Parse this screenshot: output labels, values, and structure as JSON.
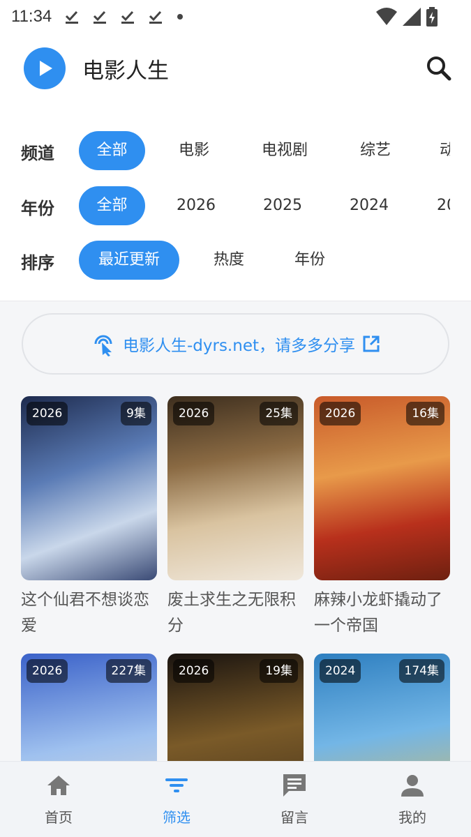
{
  "status_bar": {
    "time": "11:34"
  },
  "app": {
    "title": "电影人生"
  },
  "filters": {
    "channel": {
      "label": "频道",
      "options": [
        "全部",
        "电影",
        "电视剧",
        "综艺",
        "动"
      ]
    },
    "year": {
      "label": "年份",
      "options": [
        "全部",
        "2026",
        "2025",
        "2024",
        "20"
      ]
    },
    "sort": {
      "label": "排序",
      "options": [
        "最近更新",
        "热度",
        "年份"
      ]
    }
  },
  "share": {
    "text": "电影人生-dyrs.net，请多多分享"
  },
  "cards": [
    {
      "year": "2026",
      "episodes": "9集",
      "title": "这个仙君不想谈恋爱"
    },
    {
      "year": "2026",
      "episodes": "25集",
      "title": "废土求生之无限积分"
    },
    {
      "year": "2026",
      "episodes": "16集",
      "title": "麻辣小龙虾撬动了一个帝国"
    },
    {
      "year": "2026",
      "episodes": "227集",
      "title": ""
    },
    {
      "year": "2026",
      "episodes": "19集",
      "title": ""
    },
    {
      "year": "2024",
      "episodes": "174集",
      "title": ""
    }
  ],
  "bottom_nav": [
    {
      "label": "首页",
      "icon": "home-icon"
    },
    {
      "label": "筛选",
      "icon": "filter-icon"
    },
    {
      "label": "留言",
      "icon": "message-icon"
    },
    {
      "label": "我的",
      "icon": "person-icon"
    }
  ],
  "colors": {
    "accent": "#2f8ff0",
    "background": "#f5f6f8"
  }
}
